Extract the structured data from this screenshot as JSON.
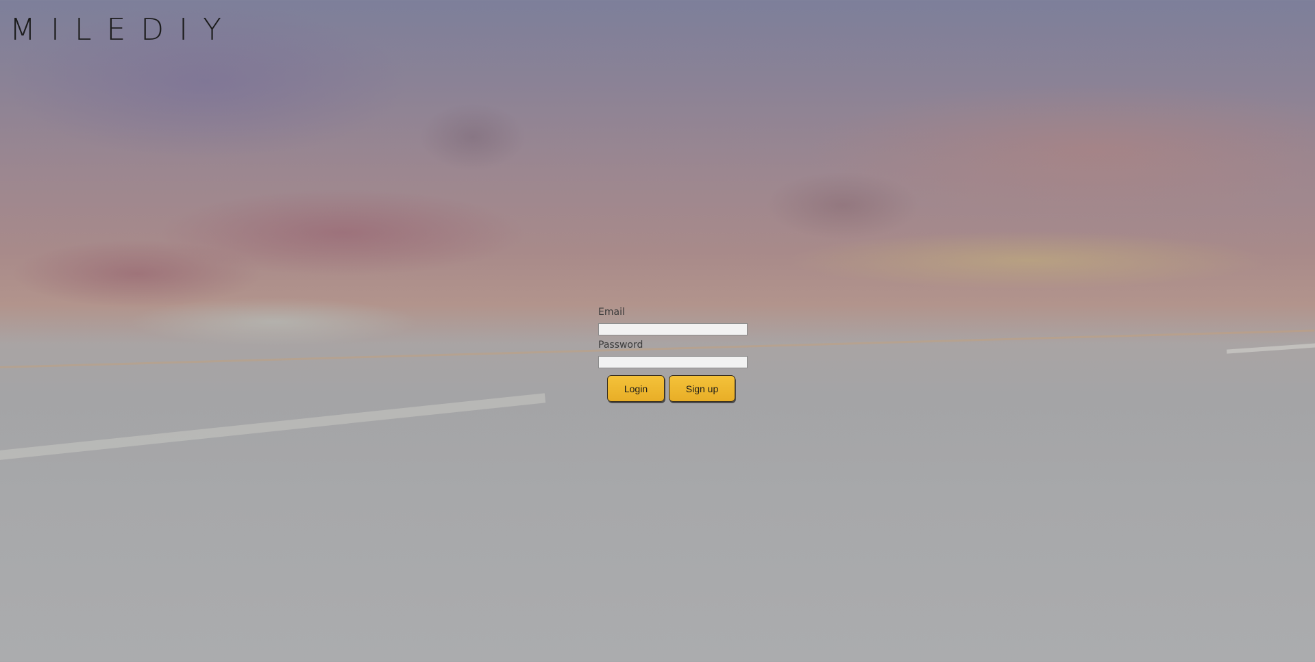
{
  "brand": {
    "logo_text": "MILEDIY"
  },
  "login_form": {
    "email_label": "Email",
    "email_value": "",
    "password_label": "Password",
    "password_value": "",
    "login_button": "Login",
    "signup_button": "Sign up"
  },
  "colors": {
    "button_accent": "#f0b92f",
    "logo": "#1c1c1c"
  }
}
